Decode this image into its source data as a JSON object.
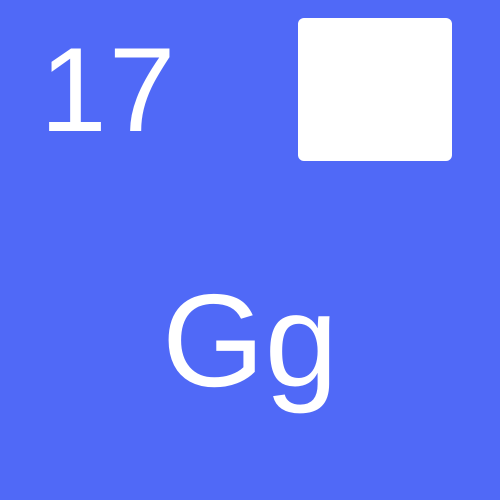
{
  "tile": {
    "number": "17",
    "symbol": "Gg",
    "background_color": "#5069F7",
    "foreground_color": "#FFFFFF"
  }
}
